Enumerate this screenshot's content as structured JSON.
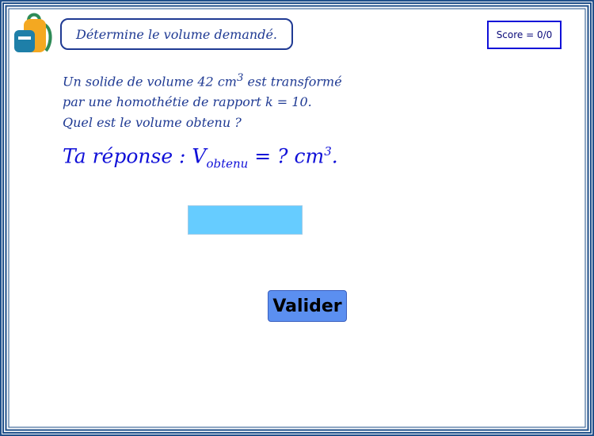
{
  "colors": {
    "frame_blue": "#1f4f8a",
    "text_blue": "#1f3a93",
    "input_fill": "#66ccff",
    "button_fill": "#5b8ff0"
  },
  "header": {
    "logo_icon": "backpack-icon",
    "instruction": "Détermine le volume demandé.",
    "score": "Score = 0/0"
  },
  "problem": {
    "line1_prefix": "Un solide de volume 42 cm",
    "line1_exp": "3",
    "line1_suffix": " est transformé",
    "line2": "par une homothétie de rapport k =  10.",
    "line3": "Quel est le volume obtenu ?"
  },
  "answer": {
    "prefix": "Ta réponse : V",
    "subscript": "obtenu",
    "middle": "  = ? cm",
    "exp": "3",
    "suffix": "."
  },
  "input": {
    "value": ""
  },
  "button": {
    "label": "Valider"
  }
}
